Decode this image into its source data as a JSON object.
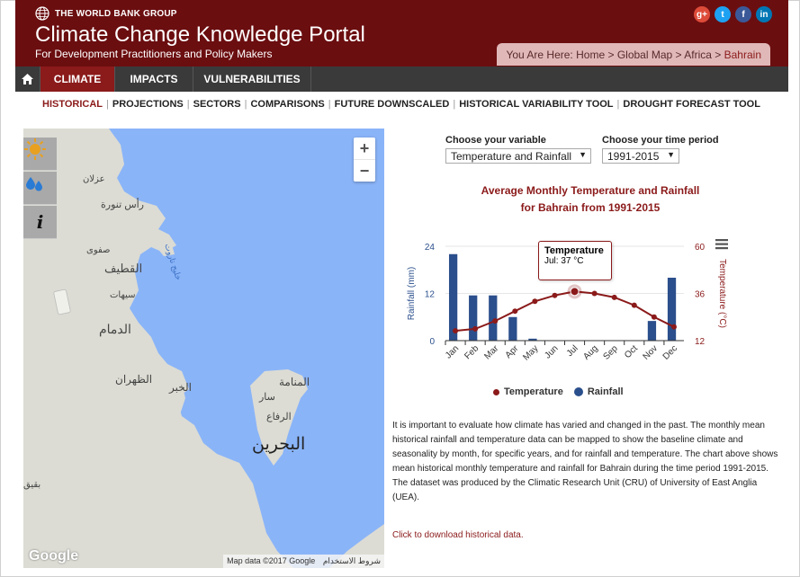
{
  "header": {
    "org": "THE WORLD BANK GROUP",
    "title": "Climate Change Knowledge Portal",
    "subtitle": "For Development Practitioners and Policy Makers",
    "social": [
      "g+",
      "t",
      "f",
      "in"
    ],
    "breadcrumb": {
      "prefix": "You Are Here:",
      "items": [
        "Home",
        "Global Map",
        "Africa",
        "Bahrain"
      ]
    }
  },
  "nav": {
    "home_icon": "home-icon",
    "items": [
      "CLIMATE",
      "IMPACTS",
      "VULNERABILITIES"
    ],
    "active": "CLIMATE"
  },
  "subnav": {
    "items": [
      "HISTORICAL",
      "PROJECTIONS",
      "SECTORS",
      "COMPARISONS",
      "FUTURE DOWNSCALED",
      "HISTORICAL VARIABILITY TOOL",
      "DROUGHT FORECAST TOOL"
    ],
    "active": "HISTORICAL"
  },
  "map": {
    "tools": [
      "sun-icon",
      "raindrop-icon",
      "info-icon"
    ],
    "zoom_in": "+",
    "zoom_out": "−",
    "labels": [
      "عزلان",
      "رأس تنورة",
      "صفوى",
      "القطيف",
      "سيهات",
      "الدمام",
      "الظهران",
      "الخبر",
      "المنامة",
      "سار",
      "الرفاع",
      "البحرين",
      "خليج تاروت",
      "بقيق"
    ],
    "google": "Google",
    "attribution": "Map data ©2017 Google",
    "terms": "شروط الاستخدام"
  },
  "controls": {
    "variable_label": "Choose your variable",
    "variable_value": "Temperature and Rainfall",
    "period_label": "Choose your time period",
    "period_value": "1991-2015"
  },
  "chart_data": {
    "type": "bar",
    "title_line1": "Average Monthly Temperature and Rainfall",
    "title_line2": "for Bahrain from 1991-2015",
    "categories": [
      "Jan",
      "Feb",
      "Mar",
      "Apr",
      "May",
      "Jun",
      "Jul",
      "Aug",
      "Sep",
      "Oct",
      "Nov",
      "Dec"
    ],
    "series": [
      {
        "name": "Rainfall",
        "axis": "left",
        "values": [
          22,
          11.5,
          11.5,
          6,
          0.5,
          0,
          0,
          0,
          0,
          0,
          5,
          16
        ],
        "color": "#2b4f8c"
      },
      {
        "name": "Temperature",
        "axis": "right",
        "values": [
          17,
          18,
          22,
          27,
          32,
          35,
          37,
          36,
          34,
          30,
          24,
          19
        ],
        "color": "#8b1a1a"
      }
    ],
    "ylabel_left": "Rainfall (mm)",
    "ylabel_right": "Temperature (°C)",
    "ylim_left": [
      0,
      24
    ],
    "ylim_right": [
      12,
      60
    ],
    "yticks_left": [
      "0",
      "12",
      "24"
    ],
    "yticks_right": [
      "12",
      "36",
      "60"
    ],
    "tooltip": {
      "title": "Temperature",
      "text": "Jul: 37 °C"
    },
    "legend_placement": "bottom"
  },
  "description": "It is important to evaluate how climate has varied and changed in the past. The monthly mean historical rainfall and temperature data can be mapped to show the baseline climate and seasonality by month, for specific years, and for rainfall and temperature. The chart above shows mean historical monthly temperature and rainfall for Bahrain during the time period 1991-2015. The dataset was produced by the Climatic Research Unit (CRU) of University of East Anglia (UEA).",
  "download_link": "Click to download historical data."
}
